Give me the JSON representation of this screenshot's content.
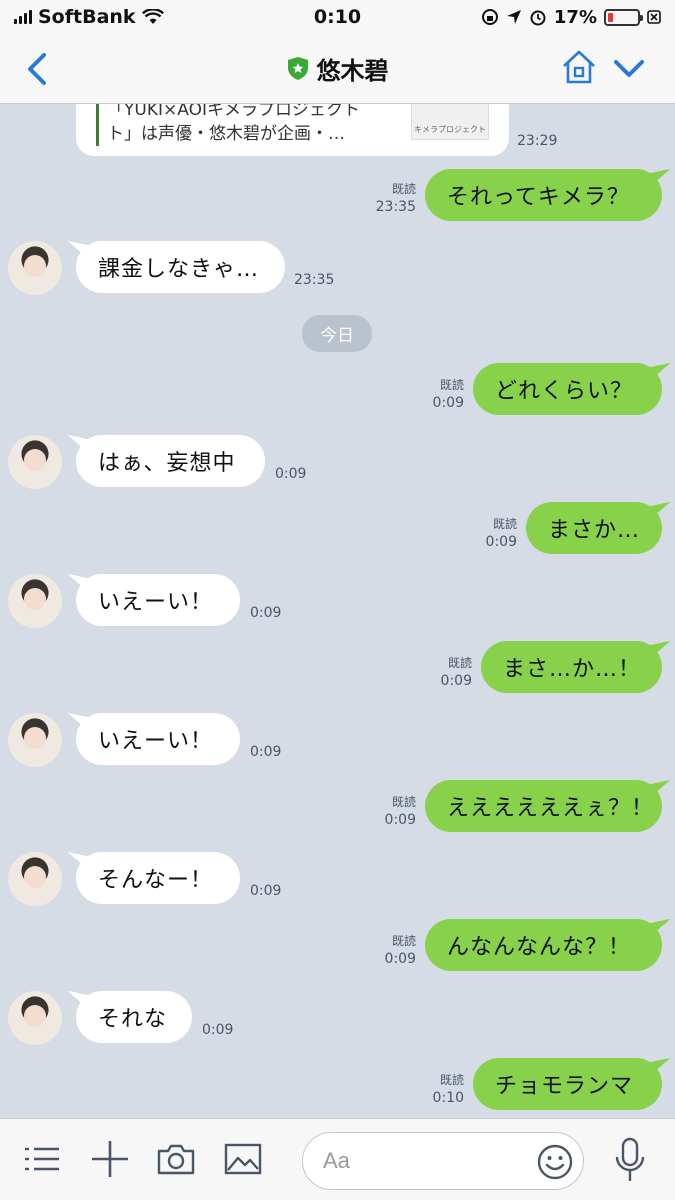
{
  "status": {
    "carrier": "SoftBank",
    "time": "0:10",
    "battery": "17%",
    "battery_level": 0.17
  },
  "nav": {
    "title": "悠木碧"
  },
  "link_preview": {
    "line1": "「YUKI×AOIキメラプロジェクト",
    "line2": "ト」は声優・悠木碧が企画・…",
    "thumb_text": "キメラプロジェクト",
    "time": "23:29"
  },
  "date_chip": "今日",
  "read_label": "既読",
  "messages": [
    {
      "dir": "out",
      "text": "それってキメラ？",
      "time": "23:35"
    },
    {
      "dir": "in",
      "text": "課金しなきゃ…",
      "time": "23:35"
    },
    {
      "dir": "out",
      "text": "どれくらい？",
      "time": "0:09"
    },
    {
      "dir": "in",
      "text": "はぁ、妄想中",
      "time": "0:09"
    },
    {
      "dir": "out",
      "text": "まさか…",
      "time": "0:09"
    },
    {
      "dir": "in",
      "text": "いえーい！",
      "time": "0:09"
    },
    {
      "dir": "out",
      "text": "まさ…か…！",
      "time": "0:09"
    },
    {
      "dir": "in",
      "text": "いえーい！",
      "time": "0:09"
    },
    {
      "dir": "out",
      "text": "ええええええぇ？！",
      "time": "0:09"
    },
    {
      "dir": "in",
      "text": "そんなー！",
      "time": "0:09"
    },
    {
      "dir": "out",
      "text": "んなんなんな？！",
      "time": "0:09"
    },
    {
      "dir": "in",
      "text": "それな",
      "time": "0:09"
    },
    {
      "dir": "out",
      "text": "チョモランマ",
      "time": "0:10"
    }
  ],
  "input": {
    "placeholder": "Aa"
  },
  "icons": {
    "back": "chevron-left-icon",
    "home": "home-icon",
    "down": "chevron-down-icon",
    "menu": "list-icon",
    "add": "plus-icon",
    "camera": "camera-icon",
    "image": "image-icon",
    "emoji": "smiley-icon",
    "mic": "microphone-icon"
  },
  "colors": {
    "accent": "#2a7ad5",
    "out_bubble": "#87d14b",
    "chat_bg": "#d5dce5",
    "verified": "#3aaa35"
  }
}
